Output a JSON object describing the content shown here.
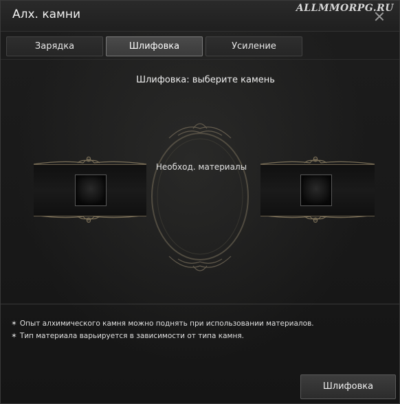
{
  "window": {
    "title": "Алх. камни",
    "watermark": "ALLMMORPG.RU"
  },
  "tabs": [
    {
      "label": "Зарядка",
      "active": false
    },
    {
      "label": "Шлифовка",
      "active": true
    },
    {
      "label": "Усиление",
      "active": false
    }
  ],
  "panel": {
    "instruction": "Шлифовка: выберите камень",
    "materials_label": "Необход. материалы"
  },
  "notes": [
    "Опыт алхимического камня можно поднять при использовании материалов.",
    "Тип материала варьируется в зависимости от типа камня."
  ],
  "footer": {
    "action_label": "Шлифовка"
  },
  "colors": {
    "ornament": "#8a7d62",
    "active_tab_border": "#7a7a7a"
  }
}
